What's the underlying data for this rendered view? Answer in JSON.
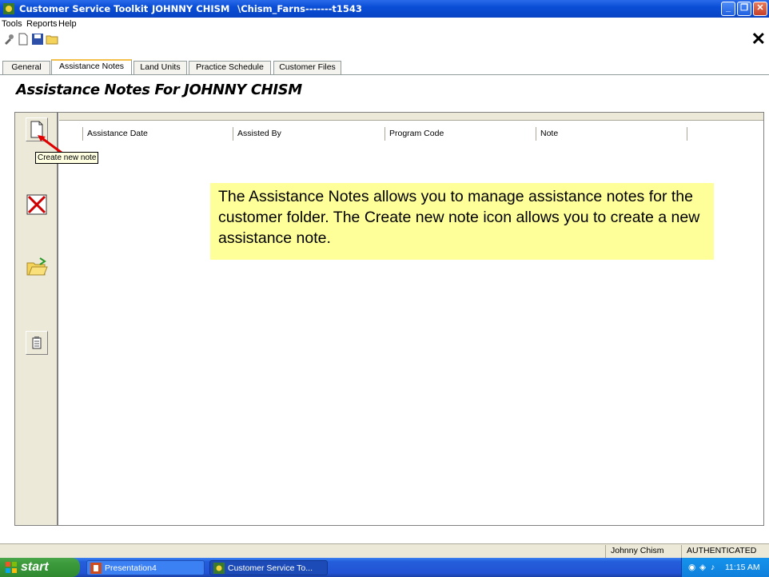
{
  "window": {
    "app_name": "Customer Service Toolkit",
    "customer": "JOHNNY CHISM",
    "folder": "\\Chism_Farns-------t1543"
  },
  "menu": [
    "Tools",
    "Reports",
    "Help"
  ],
  "toolbar": {
    "close_glyph": "✕"
  },
  "tabs": [
    "General",
    "Assistance Notes",
    "Land Units",
    "Practice Schedule",
    "Customer Files"
  ],
  "active_tab": "Assistance Notes",
  "page": {
    "heading": "Assistance Notes For   JOHNNY CHISM"
  },
  "grid": {
    "columns": [
      "Assistance Date",
      "Assisted By",
      "Program Code",
      "Note"
    ],
    "rows": []
  },
  "sidebar": {
    "buttons": [
      {
        "name": "new-note",
        "icon": "blank-page-icon",
        "tooltip": "Create new note"
      },
      {
        "name": "delete",
        "icon": "red-x-icon"
      },
      {
        "name": "open",
        "icon": "open-folder-icon"
      },
      {
        "name": "report",
        "icon": "clipboard-icon"
      }
    ]
  },
  "tooltip": "Create new note",
  "callout": "The Assistance Notes allows you to manage assistance notes for the customer folder. The Create new note icon allows you to create a new assistance note.",
  "status": {
    "user": "Johnny Chism",
    "auth": "AUTHENTICATED"
  },
  "taskbar": {
    "start": "start",
    "tasks": [
      "Presentation4",
      "Customer Service To..."
    ],
    "clock": "11:15 AM"
  },
  "colors": {
    "callout_bg": "#ffff99",
    "titlebar": "#0a4ed6",
    "arrow": "#e00000"
  }
}
